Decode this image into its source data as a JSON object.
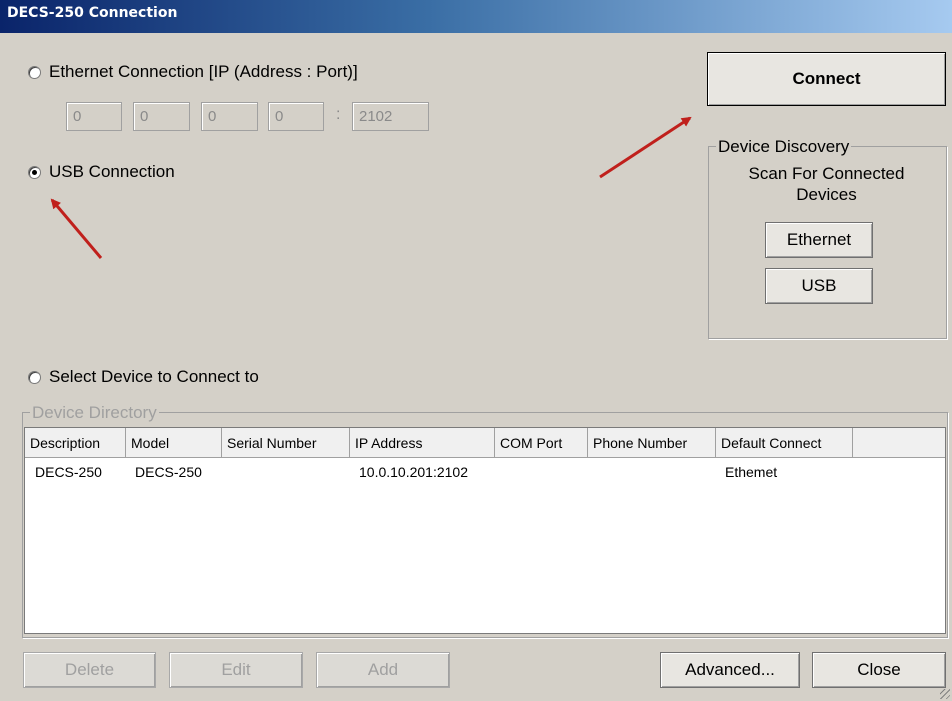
{
  "window": {
    "title": "DECS-250 Connection"
  },
  "ethernet": {
    "label": "Ethernet Connection [IP (Address : Port)]",
    "ip": [
      "0",
      "0",
      "0",
      "0"
    ],
    "separator": ":",
    "port": "2102"
  },
  "usb": {
    "label": "USB Connection"
  },
  "select_device": {
    "label": "Select Device to Connect to"
  },
  "connect": {
    "label": "Connect"
  },
  "discovery": {
    "legend": "Device Discovery",
    "caption_line1": "Scan For Connected",
    "caption_line2": "Devices",
    "ethernet_label": "Ethernet",
    "usb_label": "USB"
  },
  "directory": {
    "legend": "Device Directory",
    "columns": [
      "Description",
      "Model",
      "Serial Number",
      "IP Address",
      "COM Port",
      "Phone Number",
      "Default Connect"
    ],
    "rows": [
      [
        "DECS-250",
        "DECS-250",
        "",
        "10.0.10.201:2102",
        "",
        "",
        "Ethemet"
      ]
    ]
  },
  "footer": {
    "delete": "Delete",
    "edit": "Edit",
    "add": "Add",
    "advanced": "Advanced...",
    "close": "Close"
  },
  "colors": {
    "annotation_arrow": "#c0201c",
    "title_gradient_start": "#0a246a"
  }
}
